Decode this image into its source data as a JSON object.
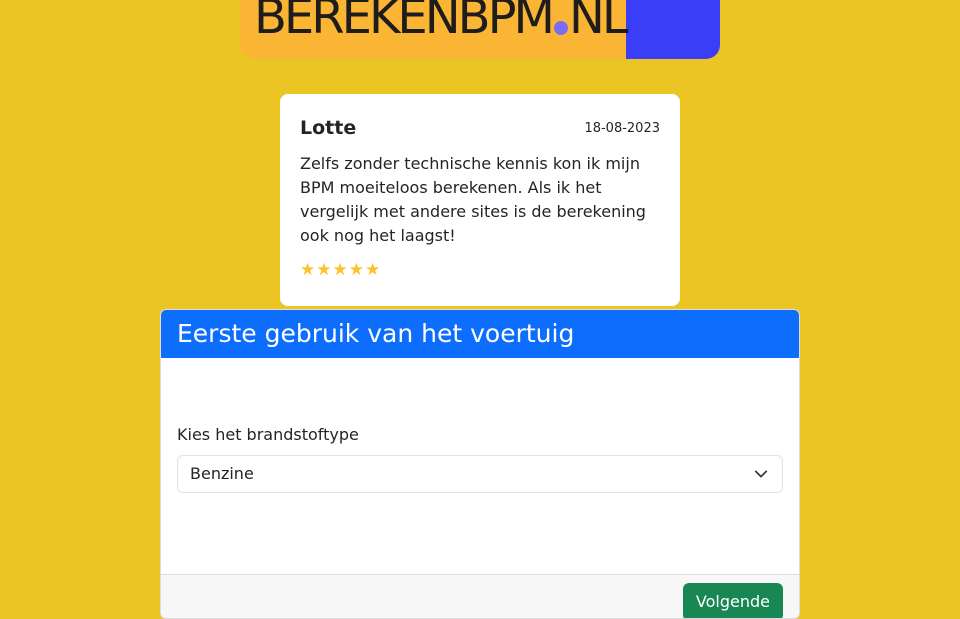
{
  "logo": {
    "text_main": "BEREKENBPM",
    "text_suffix": "NL",
    "colors": {
      "left": "#fbb535",
      "right": "#3b3ef7",
      "dot": "#7c6cf6"
    }
  },
  "review": {
    "name": "Lotte",
    "date": "18-08-2023",
    "text": "Zelfs zonder technische kennis kon ik mijn BPM moeiteloos berekenen. Als ik het vergelijk met andere sites is de berekening ook nog het laagst!",
    "stars": "★★★★★",
    "rating": 5
  },
  "form": {
    "title": "Eerste gebruik van het voertuig",
    "fuel_label": "Kies het brandstoftype",
    "fuel_selected": "Benzine",
    "next_label": "Volgende"
  },
  "colors": {
    "background": "#ebc523",
    "header": "#0d6efd",
    "button": "#198754",
    "stars": "#f8c42c"
  },
  "icons": {
    "select": "chevron-down-icon"
  }
}
